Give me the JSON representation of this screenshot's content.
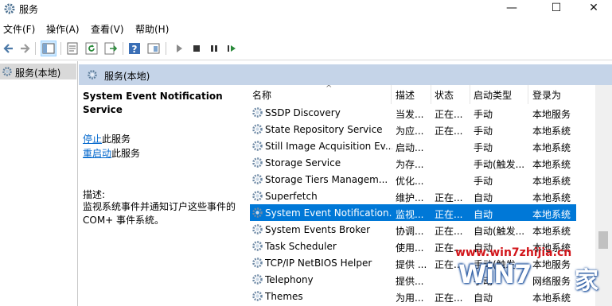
{
  "window": {
    "title": "服务",
    "buttons": {
      "minimize": "—",
      "maximize": "☐",
      "close": "✕"
    }
  },
  "menu": [
    "文件(F)",
    "操作(A)",
    "查看(V)",
    "帮助(H)"
  ],
  "toolbar": {
    "icons": [
      "back-arrow-icon",
      "forward-arrow-icon",
      "show-hide-tree-icon",
      "properties-icon",
      "refresh-icon",
      "export-list-icon",
      "help-icon",
      "view-icon",
      "start-service-icon",
      "stop-service-icon",
      "pause-service-icon",
      "restart-service-icon"
    ]
  },
  "tree": {
    "item_label": "服务(本地)"
  },
  "main_header": {
    "label": "服务(本地)"
  },
  "details": {
    "service_title": "System Event Notification Service",
    "stop_link": "停止",
    "stop_suffix": "此服务",
    "restart_link": "重启动",
    "restart_suffix": "此服务",
    "desc_label": "描述:",
    "desc_text": "监视系统事件并通知订户这些事件的COM+ 事件系统。"
  },
  "columns": {
    "name": "名称",
    "desc": "描述",
    "status": "状态",
    "startup": "启动类型",
    "logon": "登录为"
  },
  "rows": [
    {
      "name": "SSDP Discovery",
      "desc": "当发...",
      "status": "正在...",
      "startup": "手动",
      "logon": "本地服务"
    },
    {
      "name": "State Repository Service",
      "desc": "为应...",
      "status": "正在...",
      "startup": "手动",
      "logon": "本地系统"
    },
    {
      "name": "Still Image Acquisition Ev...",
      "desc": "启动...",
      "status": "",
      "startup": "手动",
      "logon": "本地系统"
    },
    {
      "name": "Storage Service",
      "desc": "为存...",
      "status": "",
      "startup": "手动(触发...",
      "logon": "本地系统"
    },
    {
      "name": "Storage Tiers Managem...",
      "desc": "优化...",
      "status": "",
      "startup": "手动",
      "logon": "本地系统"
    },
    {
      "name": "Superfetch",
      "desc": "维护...",
      "status": "正在...",
      "startup": "自动",
      "logon": "本地系统"
    },
    {
      "name": "System Event Notification...",
      "desc": "监视...",
      "status": "正在...",
      "startup": "自动",
      "logon": "本地系统",
      "selected": true
    },
    {
      "name": "System Events Broker",
      "desc": "协调...",
      "status": "正在...",
      "startup": "自动(触发...",
      "logon": "本地系统"
    },
    {
      "name": "Task Scheduler",
      "desc": "使用...",
      "status": "正在...",
      "startup": "自动",
      "logon": "本地系统"
    },
    {
      "name": "TCP/IP NetBIOS Helper",
      "desc": "提供 ...",
      "status": "正在...",
      "startup": "手动(触发...",
      "logon": "本地服务"
    },
    {
      "name": "Telephony",
      "desc": "提供...",
      "status": "",
      "startup": "手动",
      "logon": "网络服务"
    },
    {
      "name": "Themes",
      "desc": "为用...",
      "status": "正在...",
      "startup": "自动",
      "logon": "本地系统"
    }
  ],
  "colors": {
    "selection": "#0078d7",
    "header_band": "#c5d4e8",
    "link": "#0066cc"
  },
  "watermark": {
    "url": "www.win7zhijia.cn",
    "logo": "WiN7",
    "suffix": "家"
  }
}
